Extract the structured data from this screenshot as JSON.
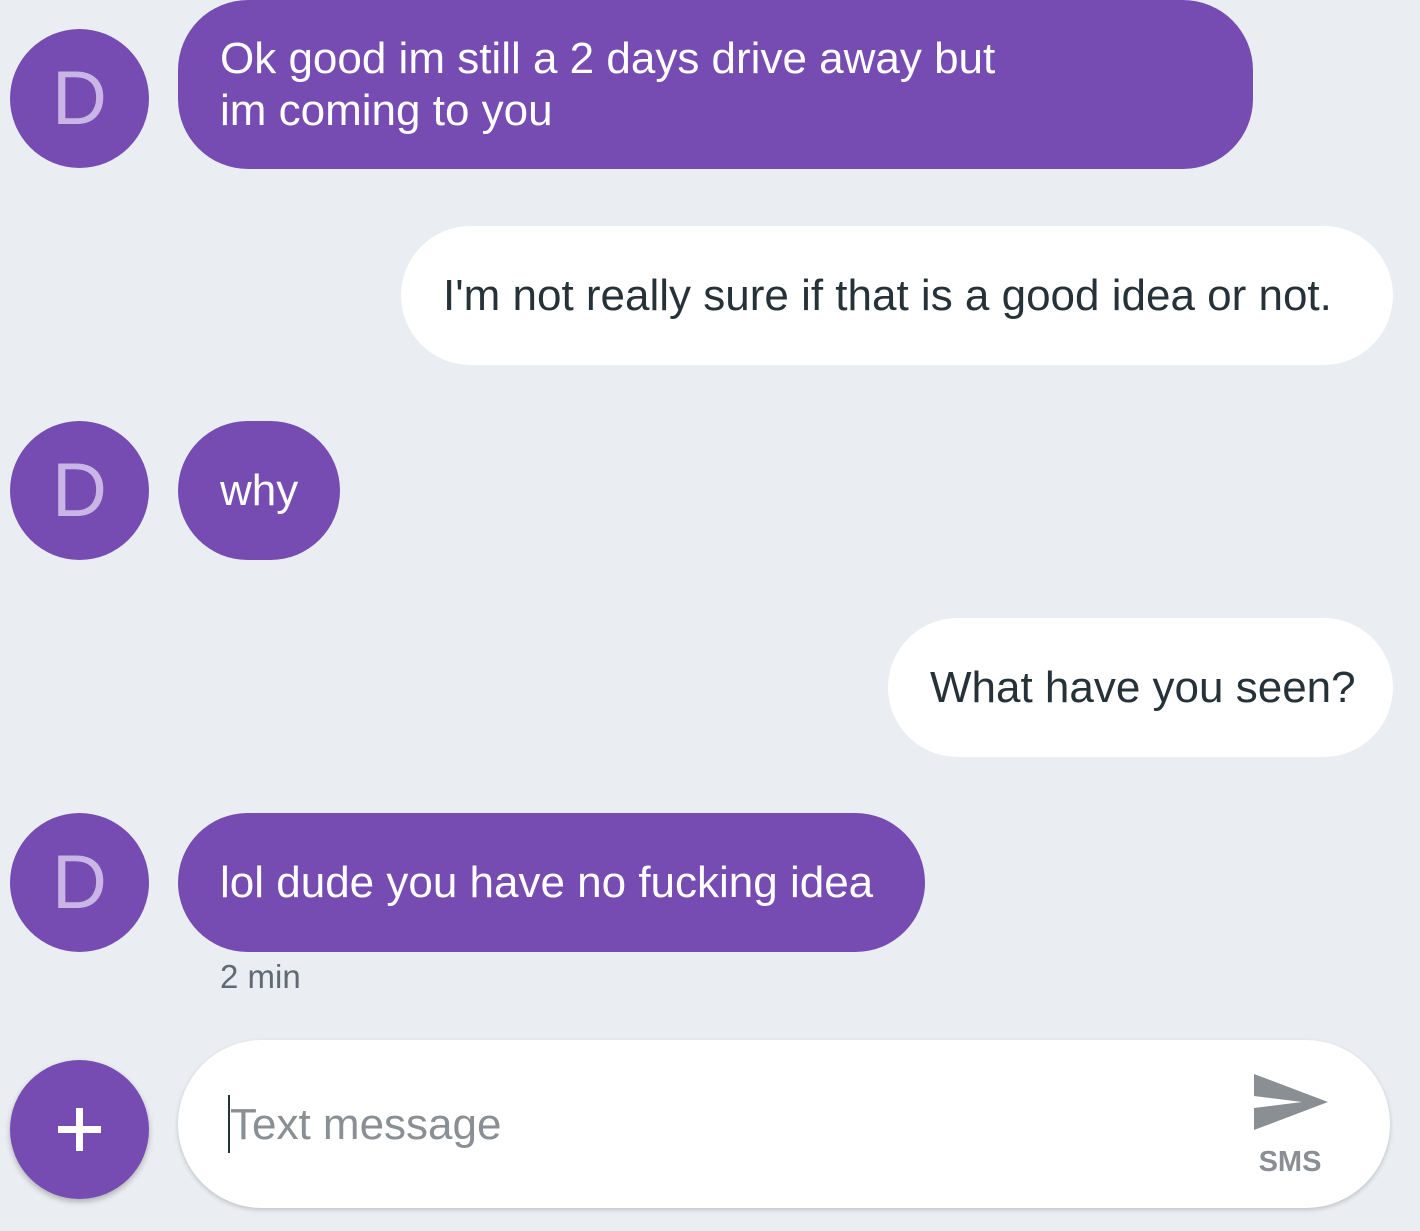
{
  "avatar_initial": "D",
  "messages": [
    {
      "direction": "incoming",
      "lines": [
        "Ok good im still a 2 days drive away but",
        "im coming to you"
      ]
    },
    {
      "direction": "outgoing",
      "text": "I'm not really sure if that is a good idea or not."
    },
    {
      "direction": "incoming",
      "text": "why"
    },
    {
      "direction": "outgoing",
      "text": "What have you seen?"
    },
    {
      "direction": "incoming",
      "text": "lol dude you have no fucking idea"
    }
  ],
  "last_message_time": "2 min",
  "composer": {
    "placeholder": "Text message",
    "value": "",
    "send_label": "SMS"
  },
  "colors": {
    "background": "#eaedf1",
    "incoming_bubble": "#764cb2",
    "outgoing_bubble": "#ffffff",
    "avatar_letter": "#c9b5e6"
  },
  "icons": [
    "add-icon",
    "send-icon"
  ]
}
